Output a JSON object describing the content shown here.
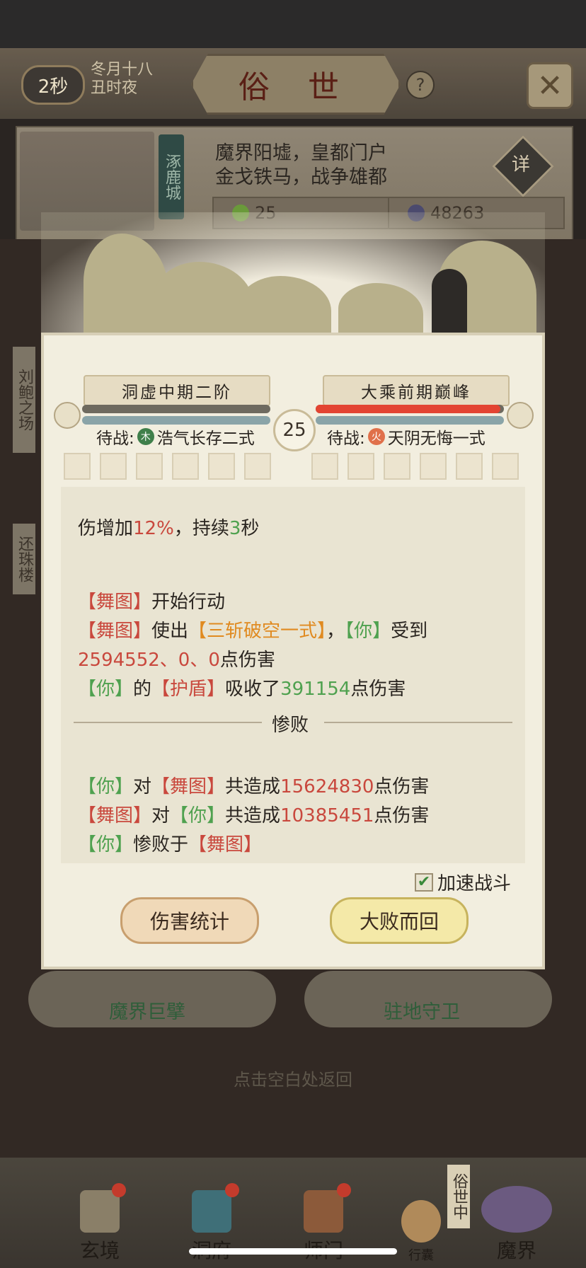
{
  "header": {
    "timer": "2秒",
    "date_line1": "冬月十八",
    "date_line2": "丑时夜",
    "title": "俗 世",
    "help": "?"
  },
  "location": {
    "city_name": "涿鹿城",
    "desc_line1": "魔界阳墟，皇都门户",
    "desc_line2": "金戈铁马，战争雄都",
    "detail_button": "详",
    "resource1": "25",
    "resource2": "48263"
  },
  "side_banners": [
    "刘鲍之场",
    "还珠楼"
  ],
  "battle": {
    "player_rank": "洞虚中期二阶",
    "enemy_rank": "大乘前期巅峰",
    "round": "25",
    "player_hp": 0,
    "enemy_hp": 0.98,
    "player_standby_label": "待战:",
    "player_element": "木",
    "player_skill": "浩气长存二式",
    "enemy_standby_label": "待战:",
    "enemy_element": "火",
    "enemy_skill": "天阴无悔一式"
  },
  "log": {
    "l1_a": "伤增加",
    "l1_pct": "12%",
    "l1_b": "，持续",
    "l1_n": "3",
    "l1_c": "秒",
    "l2_name": "【舞图】",
    "l2_text": "开始行动",
    "l3_name": "【舞图】",
    "l3_a": "使出",
    "l3_skill": "【三斩破空一式】",
    "l3_b": "，",
    "l3_you": "【你】",
    "l3_c": "受到",
    "l4_nums": "2594552、0、0",
    "l4_text": "点伤害",
    "l5_you": "【你】",
    "l5_a": "的",
    "l5_shield": "【护盾】",
    "l5_b": "吸收了",
    "l5_num": "391154",
    "l5_c": "点伤害",
    "result": "惨败",
    "l6_you": "【你】",
    "l6_a": "对",
    "l6_name": "【舞图】",
    "l6_b": "共造成",
    "l6_num": "15624830",
    "l6_c": "点伤害",
    "l7_name": "【舞图】",
    "l7_a": "对",
    "l7_you": "【你】",
    "l7_b": "共造成",
    "l7_num": "10385451",
    "l7_c": "点伤害",
    "l8_you": "【你】",
    "l8_a": "惨败于",
    "l8_name": "【舞图】"
  },
  "controls": {
    "speed_label": "加速战斗",
    "damage_stats": "伤害统计",
    "retreat": "大败而回"
  },
  "below": {
    "left_role": "魔界巨擘",
    "right_role": "驻地守卫",
    "hint": "点击空白处返回"
  },
  "nav": {
    "items": [
      "玄境",
      "洞府",
      "师门",
      "行囊",
      "魔界"
    ],
    "realm_tag": "俗世中"
  },
  "colors": {
    "heal_green": "#4fa14f",
    "enemy_red": "#c9483d",
    "skill_orange": "#e08a20"
  }
}
